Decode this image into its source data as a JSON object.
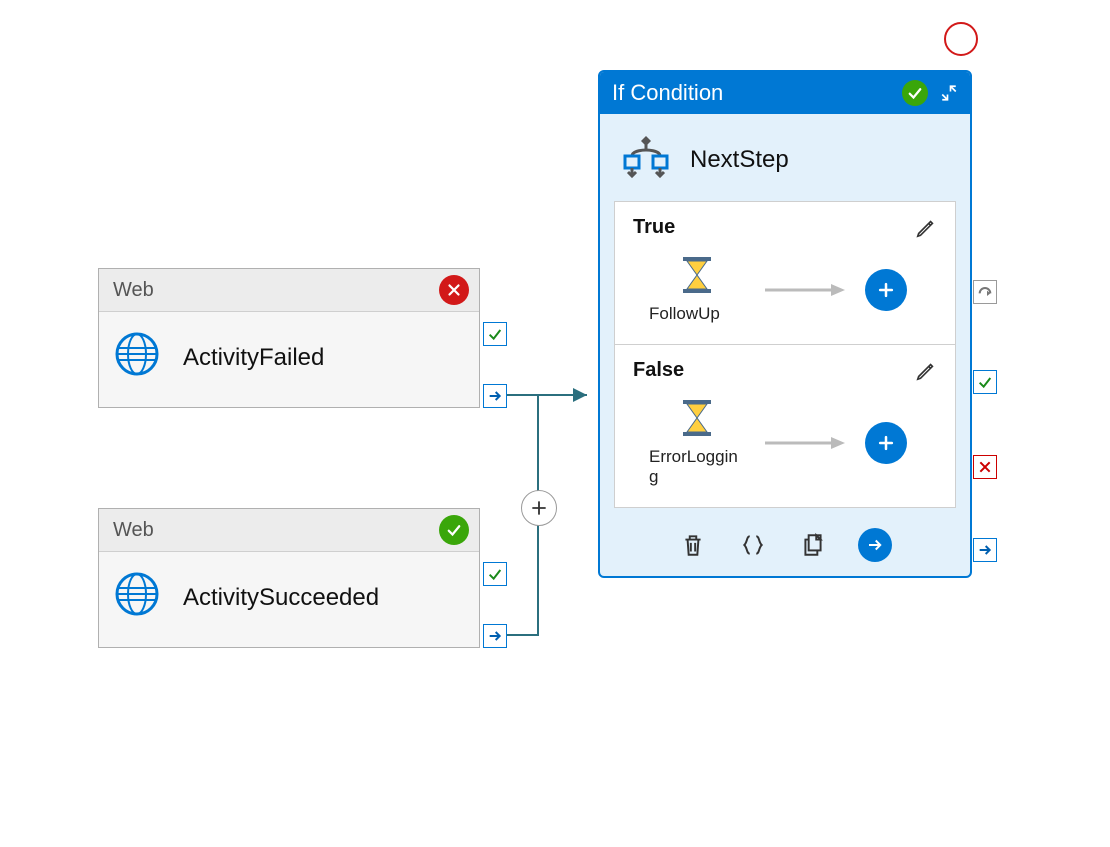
{
  "activities": {
    "failed": {
      "type": "Web",
      "name": "ActivityFailed",
      "status": "fail"
    },
    "succeeded": {
      "type": "Web",
      "name": "ActivitySucceeded",
      "status": "ok"
    }
  },
  "ifCondition": {
    "header": "If Condition",
    "name": "NextStep",
    "status": "ok",
    "branches": {
      "true": {
        "label": "True",
        "activity": "FollowUp"
      },
      "false": {
        "label": "False",
        "activity": "ErrorLogging"
      }
    }
  },
  "colors": {
    "primary": "#0078d4",
    "success": "#3aa60a",
    "error": "#d21919"
  }
}
